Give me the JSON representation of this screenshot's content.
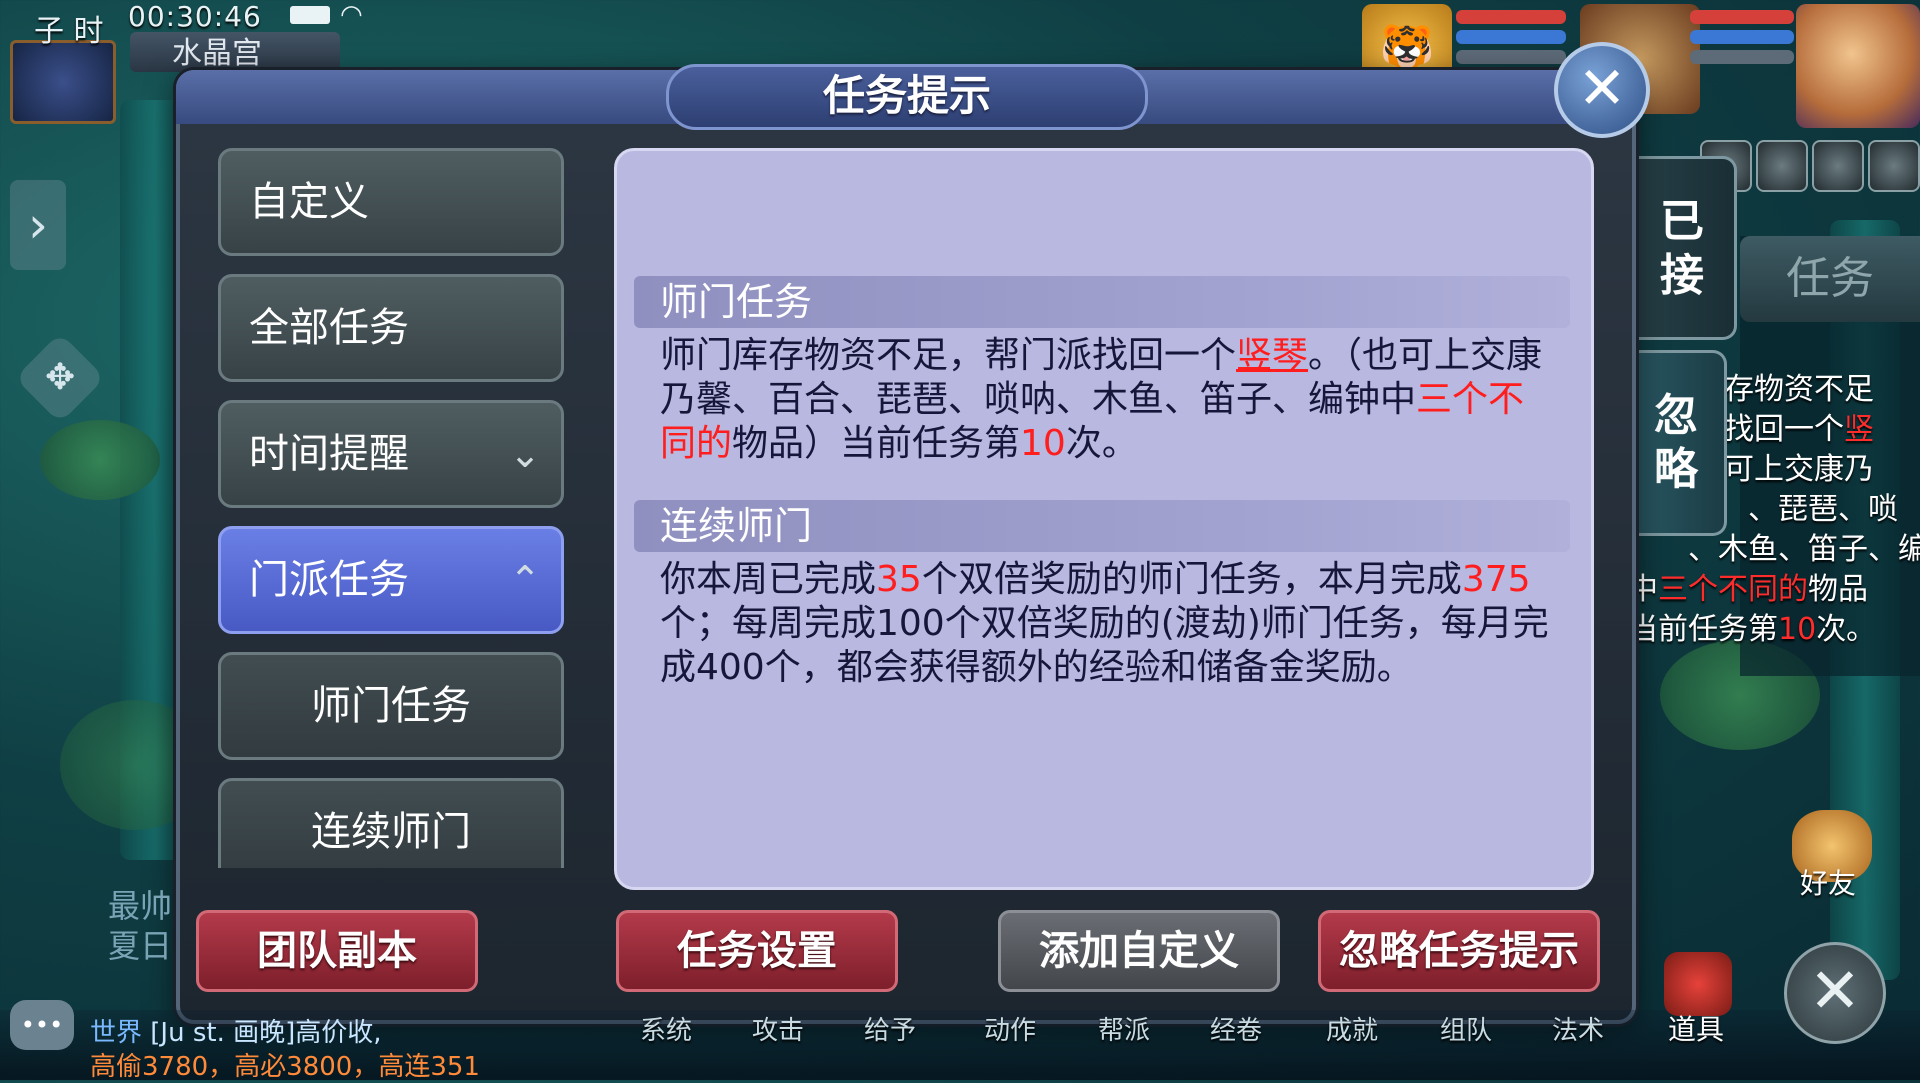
{
  "hud": {
    "shichen": "子 时",
    "clock": "00:30:46",
    "location": "水晶宫",
    "pet_glyph": "🐯"
  },
  "dialog": {
    "title": "任务提示"
  },
  "nav": {
    "items": [
      {
        "label": "自定义"
      },
      {
        "label": "全部任务"
      },
      {
        "label": "时间提醒",
        "chevron": "⌄"
      },
      {
        "label": "门派任务",
        "chevron": "⌃"
      },
      {
        "label": "师门任务"
      },
      {
        "label": "连续师门"
      }
    ]
  },
  "content": {
    "section1": {
      "header": "师门任务",
      "text_a": "师门库存物资不足，帮门派找回一个",
      "item": "竖琴",
      "text_b": "。（也可上交康乃馨、百合、琵琶、唢呐、木鱼、笛子、编钟中",
      "highlight": "三个不同的",
      "text_c": "物品）当前任务第",
      "count": "10",
      "text_d": "次。"
    },
    "section2": {
      "header": "连续师门",
      "text_a": "你本周已完成",
      "week_count": "35",
      "text_b": "个双倍奖励的师门任务，本月完成",
      "month_count": "375",
      "text_c": "个；每周完成100个双倍奖励的(渡劫)师门任务，每月完成400个，都会获得额外的经验和储备金奖励。"
    }
  },
  "side_tabs": {
    "accepted": "已接",
    "ignore": "忽略"
  },
  "buttons": {
    "team_dungeon": "团队副本",
    "task_settings": "任务设置",
    "add_custom": "添加自定义",
    "ignore_prompt": "忽略任务提示"
  },
  "right_panel": {
    "tab": "任务",
    "lines": [
      "存物资不足",
      "找回一个",
      "可上交康乃",
      "、琵琶、唢",
      "、木鱼、笛子、编",
      "中",
      "物品",
      "当前任务第",
      "次。"
    ],
    "red_item": "竖",
    "red_highlight": "三个不同的",
    "red_count": "10"
  },
  "bottom": {
    "channel": "世界",
    "chat_line1": "[Ju st. 画晚]高价收,",
    "chat_line2": "高偷3780，高必3800，高连351",
    "scroll": [
      "最帅",
      "夏日"
    ],
    "menu": [
      "系统",
      "攻击",
      "给予",
      "动作",
      "帮派",
      "经卷",
      "成就",
      "组队",
      "法术"
    ],
    "friend": "好友",
    "bag": "道具"
  }
}
